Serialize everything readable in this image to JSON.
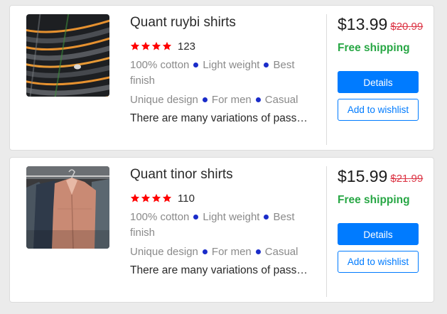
{
  "colors": {
    "background": "#ebebeb",
    "star": "#ff0000",
    "feature_dot": "#1a2cc9",
    "old_price": "#dc3545",
    "free_shipping": "#28a745",
    "primary": "#007bff"
  },
  "products": [
    {
      "image": "striped-shirts-closeup",
      "title": "Quant ruybi shirts",
      "rating_stars": 4,
      "rating_count": "123",
      "features_line1": [
        "100% cotton",
        "Light weight",
        "Best finish"
      ],
      "features_line2": [
        "Unique design",
        "For men",
        "Casual"
      ],
      "description": "There are many variations of passages of Lorem Ipsum available",
      "price": "$13.99",
      "old_price": "$20.99",
      "shipping": "Free shipping",
      "details_label": "Details",
      "wishlist_label": "Add to wishlist"
    },
    {
      "image": "shirts-on-hangers",
      "title": "Quant tinor shirts",
      "rating_stars": 4,
      "rating_count": "110",
      "features_line1": [
        "100% cotton",
        "Light weight",
        "Best finish"
      ],
      "features_line2": [
        "Unique design",
        "For men",
        "Casual"
      ],
      "description": "There are many variations of passages of Lorem Ipsum available",
      "price": "$15.99",
      "old_price": "$21.99",
      "shipping": "Free shipping",
      "details_label": "Details",
      "wishlist_label": "Add to wishlist"
    }
  ]
}
